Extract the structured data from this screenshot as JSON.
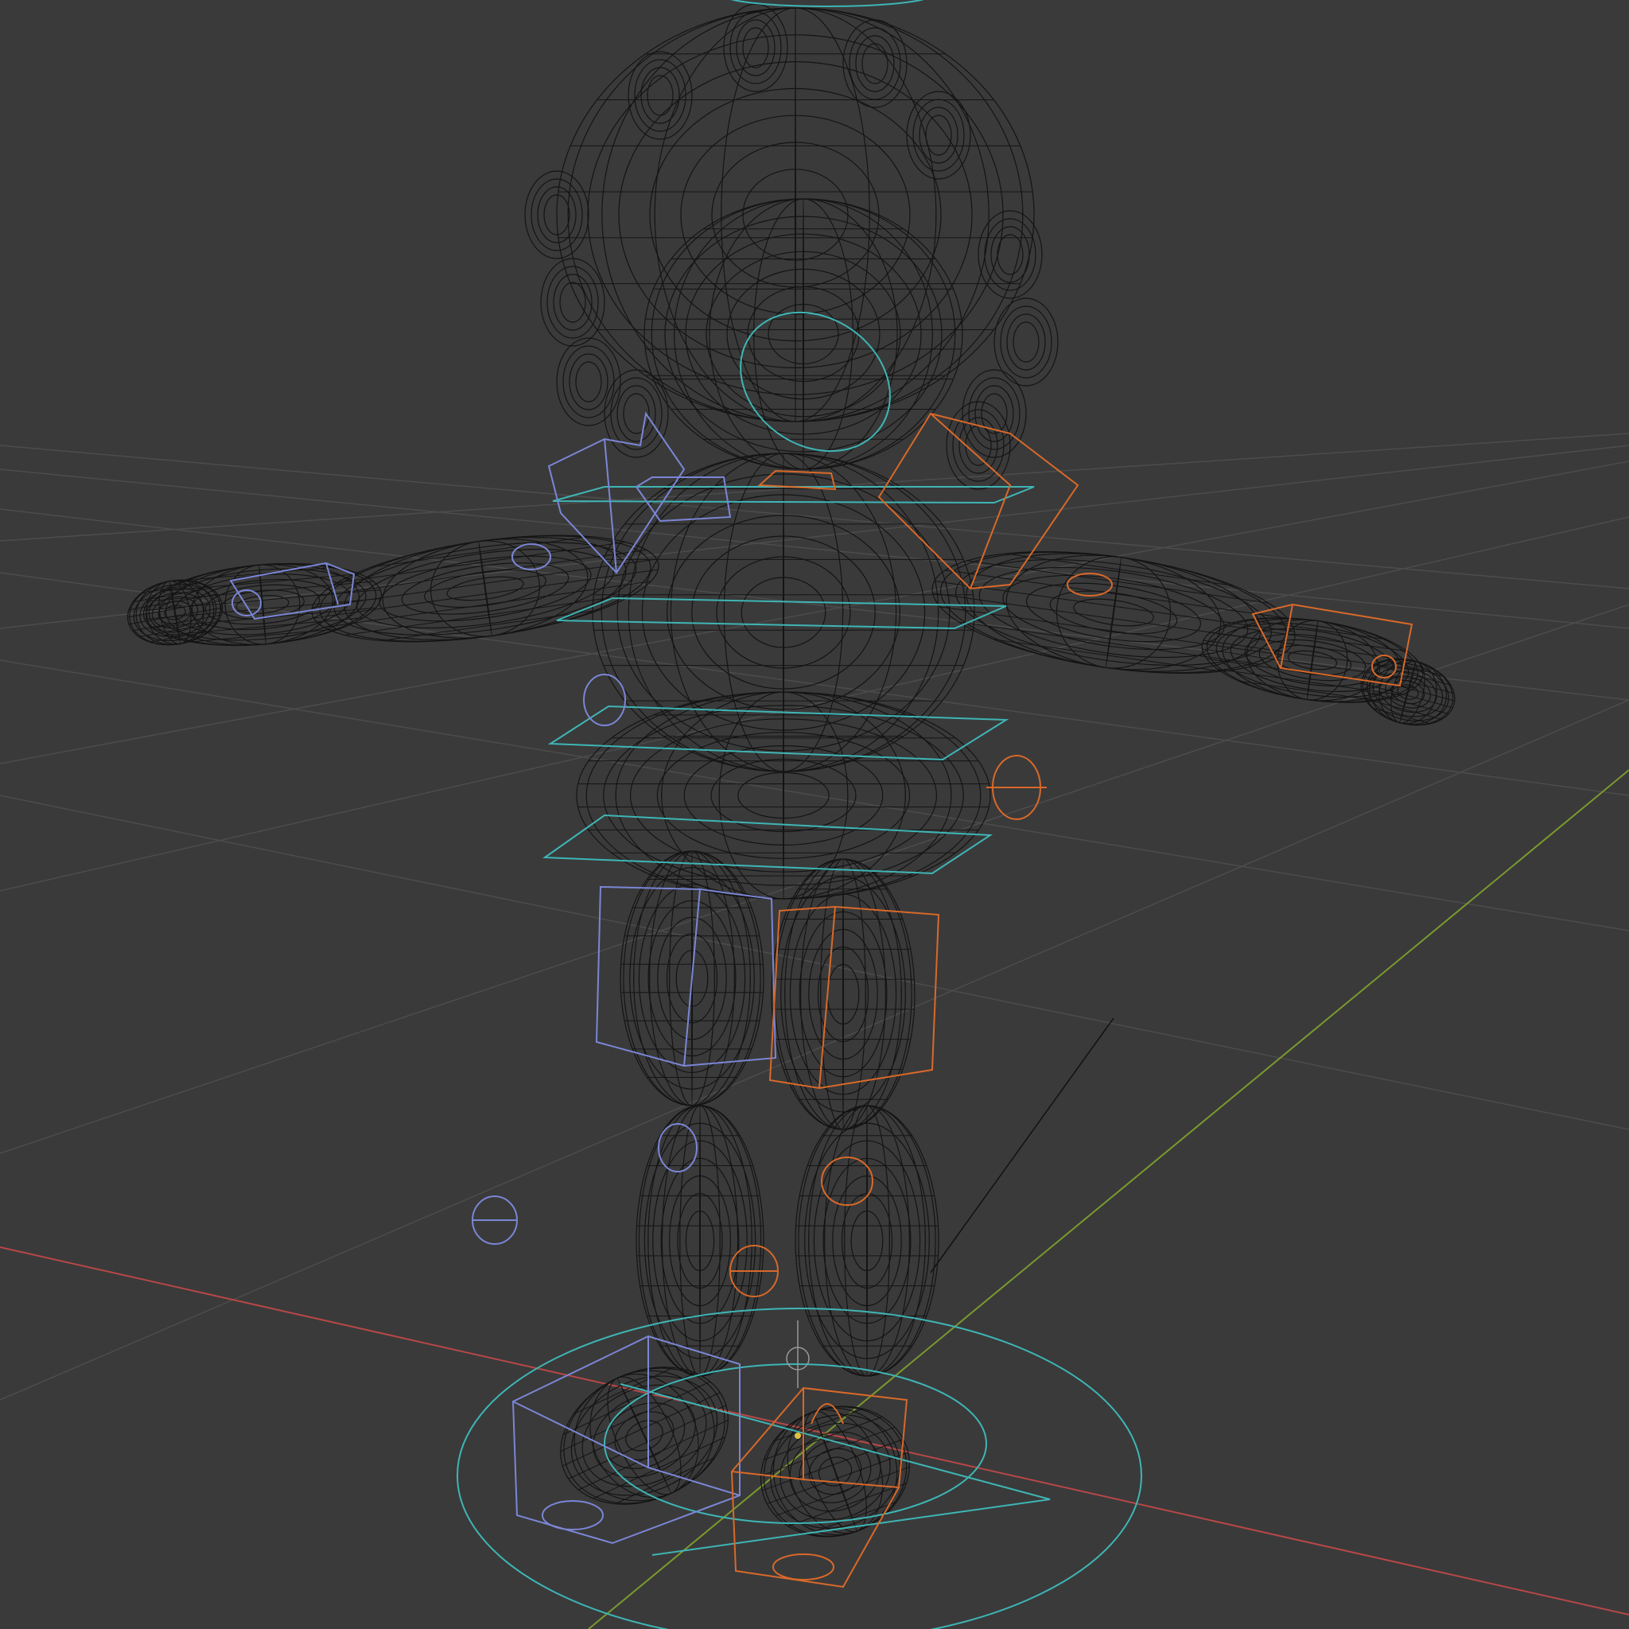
{
  "viewport": {
    "mode": "wireframe",
    "background": "#3a3a3a",
    "grid_color": "#4a4a4a",
    "axis_x_color": "#b84747",
    "axis_y_color": "#7a9a2e",
    "mesh_color": "#141414",
    "controls": {
      "root_color": "#3fb5b5",
      "left_color": "#7b86d6",
      "right_color": "#d8692a"
    },
    "objects": [
      {
        "name": "character-mesh",
        "type": "wireframe-mesh"
      },
      {
        "name": "rig-controls",
        "type": "bone-shapes"
      }
    ]
  }
}
